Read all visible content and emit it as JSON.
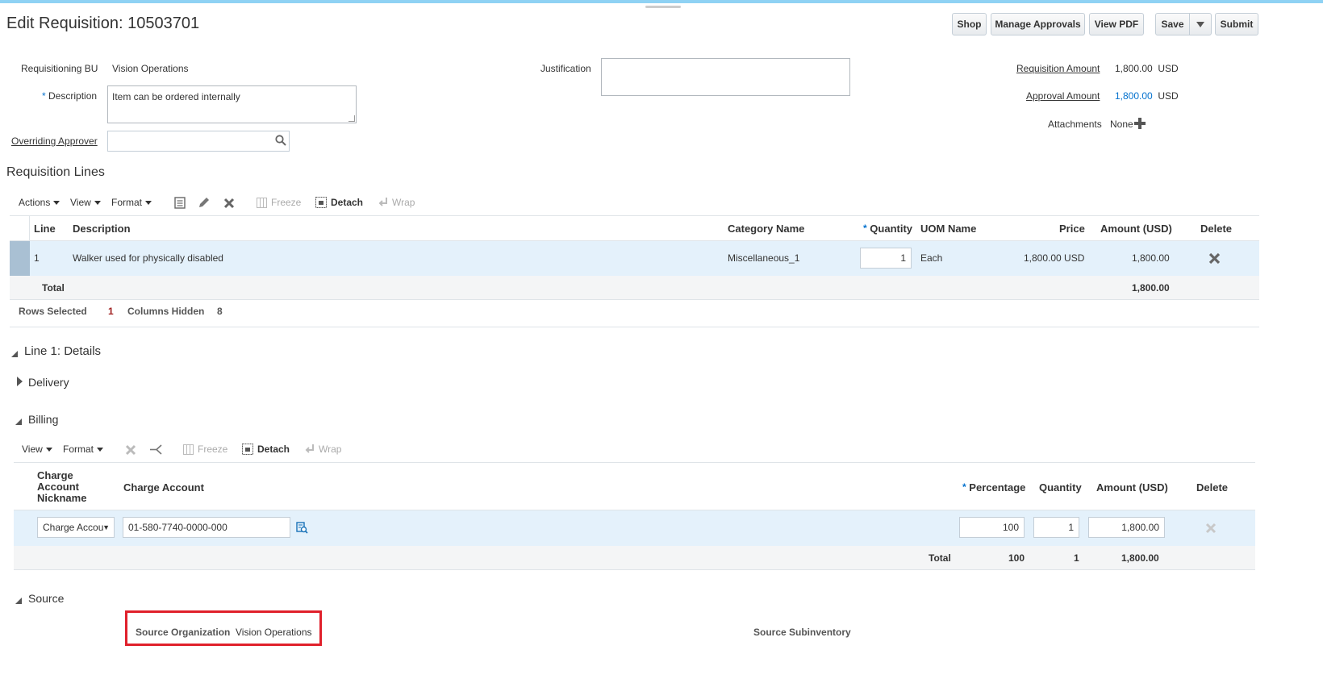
{
  "page": {
    "title": "Edit Requisition: 10503701"
  },
  "toolbar": {
    "shop": "Shop",
    "manage_approvals": "Manage Approvals",
    "view_pdf": "View PDF",
    "save": "Save",
    "submit": "Submit"
  },
  "header": {
    "req_bu_label": "Requisitioning BU",
    "req_bu_value": "Vision Operations",
    "description_label": "Description",
    "description_value": "Item can be ordered internally",
    "overriding_approver_label": "Overriding Approver",
    "overriding_approver_value": "",
    "justification_label": "Justification",
    "justification_value": "",
    "req_amount_label": "Requisition Amount",
    "req_amount_value": "1,800.00",
    "req_amount_currency": "USD",
    "approval_amount_label": "Approval Amount",
    "approval_amount_value": "1,800.00",
    "approval_amount_currency": "USD",
    "attachments_label": "Attachments",
    "attachments_value": "None"
  },
  "lines": {
    "section_title": "Requisition Lines",
    "toolbar": {
      "actions": "Actions",
      "view": "View",
      "format": "Format",
      "freeze": "Freeze",
      "detach": "Detach",
      "wrap": "Wrap"
    },
    "columns": {
      "line": "Line",
      "description": "Description",
      "category": "Category Name",
      "quantity": "Quantity",
      "uom": "UOM Name",
      "price": "Price",
      "amount": "Amount (USD)",
      "delete": "Delete"
    },
    "rows": [
      {
        "line": "1",
        "description": "Walker used for physically disabled",
        "category": "Miscellaneous_1",
        "quantity": "1",
        "uom": "Each",
        "price": "1,800.00 USD",
        "amount": "1,800.00"
      }
    ],
    "total_label": "Total",
    "total_value": "1,800.00",
    "rows_selected_label": "Rows Selected",
    "rows_selected_value": "1",
    "columns_hidden_label": "Columns Hidden",
    "columns_hidden_value": "8"
  },
  "details": {
    "title": "Line 1: Details",
    "delivery": "Delivery",
    "billing": "Billing",
    "source": "Source"
  },
  "billing": {
    "toolbar": {
      "view": "View",
      "format": "Format",
      "freeze": "Freeze",
      "detach": "Detach",
      "wrap": "Wrap"
    },
    "columns": {
      "nickname_1": "Charge",
      "nickname_2": "Account",
      "nickname_3": "Nickname",
      "charge_account": "Charge Account",
      "percentage": "Percentage",
      "quantity": "Quantity",
      "amount": "Amount (USD)",
      "delete": "Delete"
    },
    "row": {
      "nickname": "Charge Accou",
      "charge_account": "01-580-7740-0000-000",
      "percentage": "100",
      "quantity": "1",
      "amount": "1,800.00"
    },
    "total_label": "Total",
    "total_percentage": "100",
    "total_quantity": "1",
    "total_amount": "1,800.00"
  },
  "source": {
    "org_label": "Source Organization",
    "org_value": "Vision Operations",
    "subinventory_label": "Source Subinventory"
  },
  "colors": {
    "accent": "#0572ce",
    "topbar": "#8fd2f4",
    "selected_row": "#e4f1fb",
    "highlight_box": "#e0202b"
  }
}
